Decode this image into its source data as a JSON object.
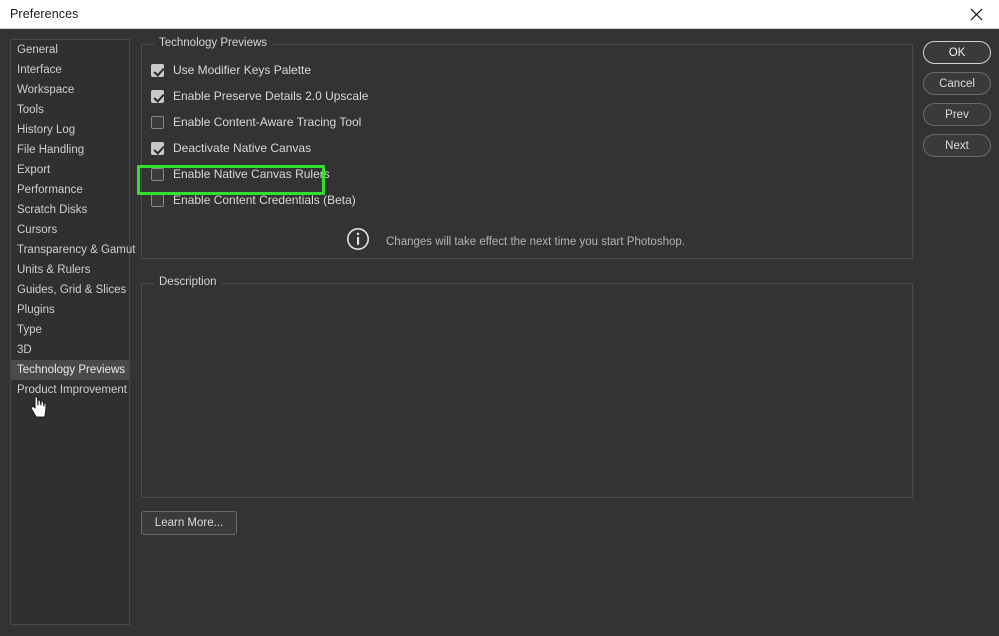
{
  "window": {
    "title": "Preferences",
    "close_icon": "close-icon"
  },
  "sidebar": {
    "items": [
      {
        "label": "General",
        "selected": false
      },
      {
        "label": "Interface",
        "selected": false
      },
      {
        "label": "Workspace",
        "selected": false
      },
      {
        "label": "Tools",
        "selected": false
      },
      {
        "label": "History Log",
        "selected": false
      },
      {
        "label": "File Handling",
        "selected": false
      },
      {
        "label": "Export",
        "selected": false
      },
      {
        "label": "Performance",
        "selected": false
      },
      {
        "label": "Scratch Disks",
        "selected": false
      },
      {
        "label": "Cursors",
        "selected": false
      },
      {
        "label": "Transparency & Gamut",
        "selected": false
      },
      {
        "label": "Units & Rulers",
        "selected": false
      },
      {
        "label": "Guides, Grid & Slices",
        "selected": false
      },
      {
        "label": "Plugins",
        "selected": false
      },
      {
        "label": "Type",
        "selected": false
      },
      {
        "label": "3D",
        "selected": false
      },
      {
        "label": "Technology Previews",
        "selected": true
      },
      {
        "label": "Product Improvement",
        "selected": false
      }
    ]
  },
  "tech_previews": {
    "group_label": "Technology Previews",
    "options": [
      {
        "label": "Use Modifier Keys Palette",
        "checked": true
      },
      {
        "label": "Enable Preserve Details 2.0 Upscale",
        "checked": true
      },
      {
        "label": "Enable Content-Aware Tracing Tool",
        "checked": false
      },
      {
        "label": "Deactivate Native Canvas",
        "checked": true
      },
      {
        "label": "Enable Native Canvas Rulers",
        "checked": false
      },
      {
        "label": "Enable Content Credentials (Beta)",
        "checked": false
      }
    ],
    "note": {
      "icon": "info-icon",
      "text": "Changes will take effect the next time you start Photoshop."
    },
    "highlight": {
      "target_label": "Deactivate Native Canvas",
      "color": "#2fe02f"
    }
  },
  "description": {
    "group_label": "Description",
    "body": ""
  },
  "learn_more": {
    "label": "Learn More..."
  },
  "buttons": [
    {
      "label": "OK",
      "primary": true
    },
    {
      "label": "Cancel",
      "primary": false
    },
    {
      "label": "Prev",
      "primary": false
    },
    {
      "label": "Next",
      "primary": false
    }
  ],
  "cursor": {
    "icon": "hand-pointer-cursor"
  }
}
